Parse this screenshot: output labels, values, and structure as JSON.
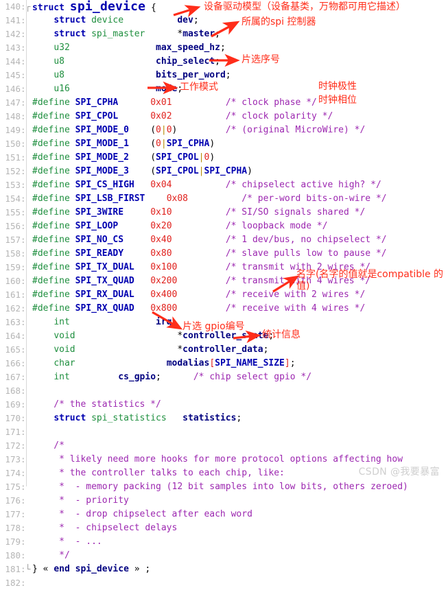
{
  "editor": {
    "first_line": 140,
    "last_line": 182,
    "fold_marker": "┌",
    "fold_marker_end": "└",
    "struct_title": "spi_device",
    "lines": [
      {
        "n": "140",
        "fold": "top",
        "text": "struct spi_device {"
      },
      {
        "n": "141",
        "fold": "body",
        "text": "    struct device          dev;"
      },
      {
        "n": "142",
        "fold": "body",
        "text": "    struct spi_master      *master;"
      },
      {
        "n": "143",
        "fold": "body",
        "text": "    u32                max_speed_hz;"
      },
      {
        "n": "144",
        "fold": "body",
        "text": "    u8                 chip_select;"
      },
      {
        "n": "145",
        "fold": "body",
        "text": "    u8                 bits_per_word;"
      },
      {
        "n": "146",
        "fold": "body",
        "text": "    u16                mode;"
      },
      {
        "n": "147",
        "fold": "body",
        "text": "#define SPI_CPHA      0x01          /* clock phase */"
      },
      {
        "n": "148",
        "fold": "body",
        "text": "#define SPI_CPOL      0x02          /* clock polarity */"
      },
      {
        "n": "149",
        "fold": "body",
        "text": "#define SPI_MODE_0    (0|0)         /* (original MicroWire) */"
      },
      {
        "n": "150",
        "fold": "body",
        "text": "#define SPI_MODE_1    (0|SPI_CPHA)"
      },
      {
        "n": "151",
        "fold": "body",
        "text": "#define SPI_MODE_2    (SPI_CPOL|0)"
      },
      {
        "n": "152",
        "fold": "body",
        "text": "#define SPI_MODE_3    (SPI_CPOL|SPI_CPHA)"
      },
      {
        "n": "153",
        "fold": "body",
        "text": "#define SPI_CS_HIGH   0x04          /* chipselect active high? */"
      },
      {
        "n": "154",
        "fold": "body",
        "text": "#define SPI_LSB_FIRST    0x08          /* per-word bits-on-wire */"
      },
      {
        "n": "155",
        "fold": "body",
        "text": "#define SPI_3WIRE     0x10          /* SI/SO signals shared */"
      },
      {
        "n": "156",
        "fold": "body",
        "text": "#define SPI_LOOP      0x20          /* loopback mode */"
      },
      {
        "n": "157",
        "fold": "body",
        "text": "#define SPI_NO_CS     0x40          /* 1 dev/bus, no chipselect */"
      },
      {
        "n": "158",
        "fold": "body",
        "text": "#define SPI_READY     0x80          /* slave pulls low to pause */"
      },
      {
        "n": "159",
        "fold": "body",
        "text": "#define SPI_TX_DUAL   0x100         /* transmit with 2 wires */"
      },
      {
        "n": "160",
        "fold": "body",
        "text": "#define SPI_TX_QUAD   0x200         /* transmit with 4 wires */"
      },
      {
        "n": "161",
        "fold": "body",
        "text": "#define SPI_RX_DUAL   0x400         /* receive with 2 wires */"
      },
      {
        "n": "162",
        "fold": "body",
        "text": "#define SPI_RX_QUAD   0x800         /* receive with 4 wires */"
      },
      {
        "n": "163",
        "fold": "body",
        "text": "    int                irq;"
      },
      {
        "n": "164",
        "fold": "body",
        "text": "    void                   *controller_state;"
      },
      {
        "n": "165",
        "fold": "body",
        "text": "    void                   *controller_data;"
      },
      {
        "n": "166",
        "fold": "body",
        "text": "    char                 modalias[SPI_NAME_SIZE];"
      },
      {
        "n": "167",
        "fold": "body",
        "text": "    int         cs_gpio;      /* chip select gpio */"
      },
      {
        "n": "168",
        "fold": "body",
        "text": ""
      },
      {
        "n": "169",
        "fold": "body",
        "text": "    /* the statistics */"
      },
      {
        "n": "170",
        "fold": "body",
        "text": "    struct spi_statistics   statistics;"
      },
      {
        "n": "171",
        "fold": "body",
        "text": ""
      },
      {
        "n": "172",
        "fold": "body",
        "text": "    /*"
      },
      {
        "n": "173",
        "fold": "body",
        "text": "     * likely need more hooks for more protocol options affecting how"
      },
      {
        "n": "174",
        "fold": "body",
        "text": "     * the controller talks to each chip, like:"
      },
      {
        "n": "175",
        "fold": "body",
        "text": "     *  - memory packing (12 bit samples into low bits, others zeroed)"
      },
      {
        "n": "176",
        "fold": "body",
        "text": "     *  - priority"
      },
      {
        "n": "177",
        "fold": "body",
        "text": "     *  - drop chipselect after each word"
      },
      {
        "n": "178",
        "fold": "body",
        "text": "     *  - chipselect delays"
      },
      {
        "n": "179",
        "fold": "body",
        "text": "     *  - ..."
      },
      {
        "n": "180",
        "fold": "body",
        "text": "     */"
      },
      {
        "n": "181",
        "fold": "end",
        "text": "} « end spi_device » ;"
      },
      {
        "n": "182",
        "fold": "none",
        "text": ""
      }
    ]
  },
  "annotations": [
    {
      "id": "a1",
      "text": "设备驱动模型（设备基类，万物都可用它描述）"
    },
    {
      "id": "a2",
      "text": "所属的spi 控制器"
    },
    {
      "id": "a3",
      "text": "片选序号"
    },
    {
      "id": "a4",
      "text": "工作模式"
    },
    {
      "id": "a5",
      "text": "时钟极性"
    },
    {
      "id": "a6",
      "text": "时钟相位"
    },
    {
      "id": "a7",
      "text": "名字(名字的值就是compatible 的值)"
    },
    {
      "id": "a8",
      "text": "片选 gpio编号"
    },
    {
      "id": "a9",
      "text": "统计信息"
    }
  ],
  "watermark": {
    "text": "CSDN @我要暴富"
  },
  "colors": {
    "annotation": "#ff2d1a",
    "keyword": "#0000b0",
    "type": "#1f8f3f",
    "number": "#e0211d",
    "comment": "#9c27b0",
    "gutter": "#b5b5b5",
    "background": "#ffffff",
    "watermark": "#cfcfcf"
  }
}
